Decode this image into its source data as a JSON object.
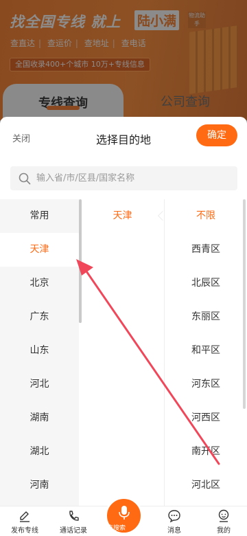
{
  "banner": {
    "headline": "找全国专线  就上",
    "brand": "陆小满",
    "brand_tag": "物流助手",
    "links": [
      "查直达",
      "查运价",
      "查地址",
      "查电话"
    ],
    "pill": "全国收录400+个城市 10万+专线信息",
    "tabs": [
      "专线查询",
      "公司查询"
    ]
  },
  "sheet": {
    "close_label": "关闭",
    "title": "选择目的地",
    "confirm_label": "确定",
    "search_placeholder": "输入省/市/区县/国家名称"
  },
  "provinces": [
    "常用",
    "天津",
    "北京",
    "广东",
    "山东",
    "河北",
    "湖南",
    "湖北",
    "河南"
  ],
  "provinces_selected": "天津",
  "cities": [
    "天津"
  ],
  "districts": [
    "不限",
    "西青区",
    "北辰区",
    "东丽区",
    "和平区",
    "河东区",
    "河西区",
    "南开区",
    "河北区"
  ],
  "nav": {
    "publish": "发布专线",
    "records": "通话记录",
    "search": "点搜索",
    "messages": "消息",
    "mine": "我的"
  },
  "colors": {
    "accent": "#ff6a13",
    "annotation_arrow": "#f0485a"
  }
}
